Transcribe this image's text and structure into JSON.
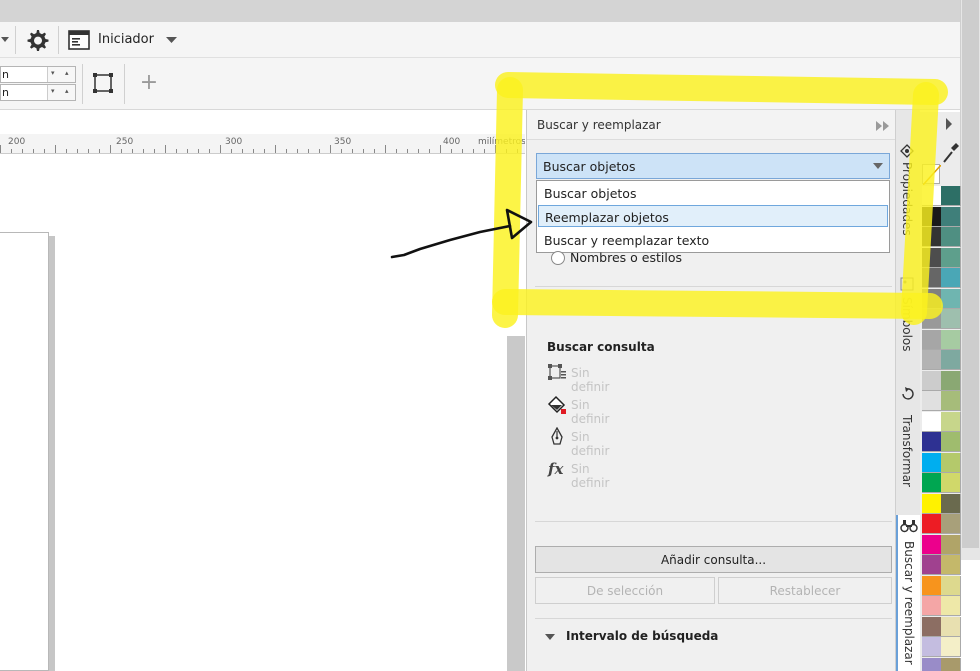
{
  "toolbar": {
    "launcher_label": "Iniciador",
    "plus_label": "+",
    "spin1_value": "n",
    "spin2_value": "n"
  },
  "ruler": {
    "labels": [
      "200",
      "250",
      "300",
      "350",
      "400"
    ],
    "unit": "milímetros"
  },
  "docker": {
    "title": "Buscar y reemplazar",
    "select_value": "Buscar objetos",
    "options": [
      "Buscar objetos",
      "Reemplazar objetos",
      "Buscar y reemplazar texto"
    ],
    "highlighted_option": 1,
    "radio_label": "Nombres o estilos",
    "query_title": "Buscar consulta",
    "query_rows": [
      "Sin definir",
      "Sin definir",
      "Sin definir",
      "Sin definir"
    ],
    "add_query_button": "Añadir consulta...",
    "from_selection_button": "De selección",
    "reset_button": "Restablecer",
    "range_title": "Intervalo de búsqueda"
  },
  "side_tabs": [
    "Propiedades",
    "Símbolos",
    "Transformar",
    "Buscar y reemplazar"
  ],
  "palette": {
    "left": [
      "#ffffff",
      "#1a1a1a",
      "#333333",
      "#4d4d4d",
      "#666666",
      "#808080",
      "#999999",
      "#a6a6a6",
      "#b3b3b3",
      "#cccccc",
      "#e0e0e0",
      "#ffffff",
      "#2e3192",
      "#00aeef",
      "#00a651",
      "#fff200",
      "#ed1c24",
      "#ec008c",
      "#a0418f",
      "#f7941d",
      "#f4a6a6",
      "#8c6e63",
      "#c4bde0",
      "#998cc8"
    ],
    "right": [
      "#2d6f66",
      "#3f7f7a",
      "#4f8f82",
      "#5e9f8c",
      "#4aa7b6",
      "#6fb5b0",
      "#9ebfae",
      "#a6cba2",
      "#7ea9a0",
      "#8aa873",
      "#a6bc7a",
      "#c7d68b",
      "#9fbc6e",
      "#b4c96b",
      "#d0d86a",
      "#6a6a4e",
      "#a8a07a",
      "#b0a468",
      "#c4b86a",
      "#ddd98e",
      "#eee8a8",
      "#e8e0b0",
      "#f4efc8",
      "#a89a6b"
    ]
  },
  "colors": {
    "highlight": "#fcf534",
    "select_bg": "#cde3f7",
    "option_hl": "#e1effa"
  }
}
